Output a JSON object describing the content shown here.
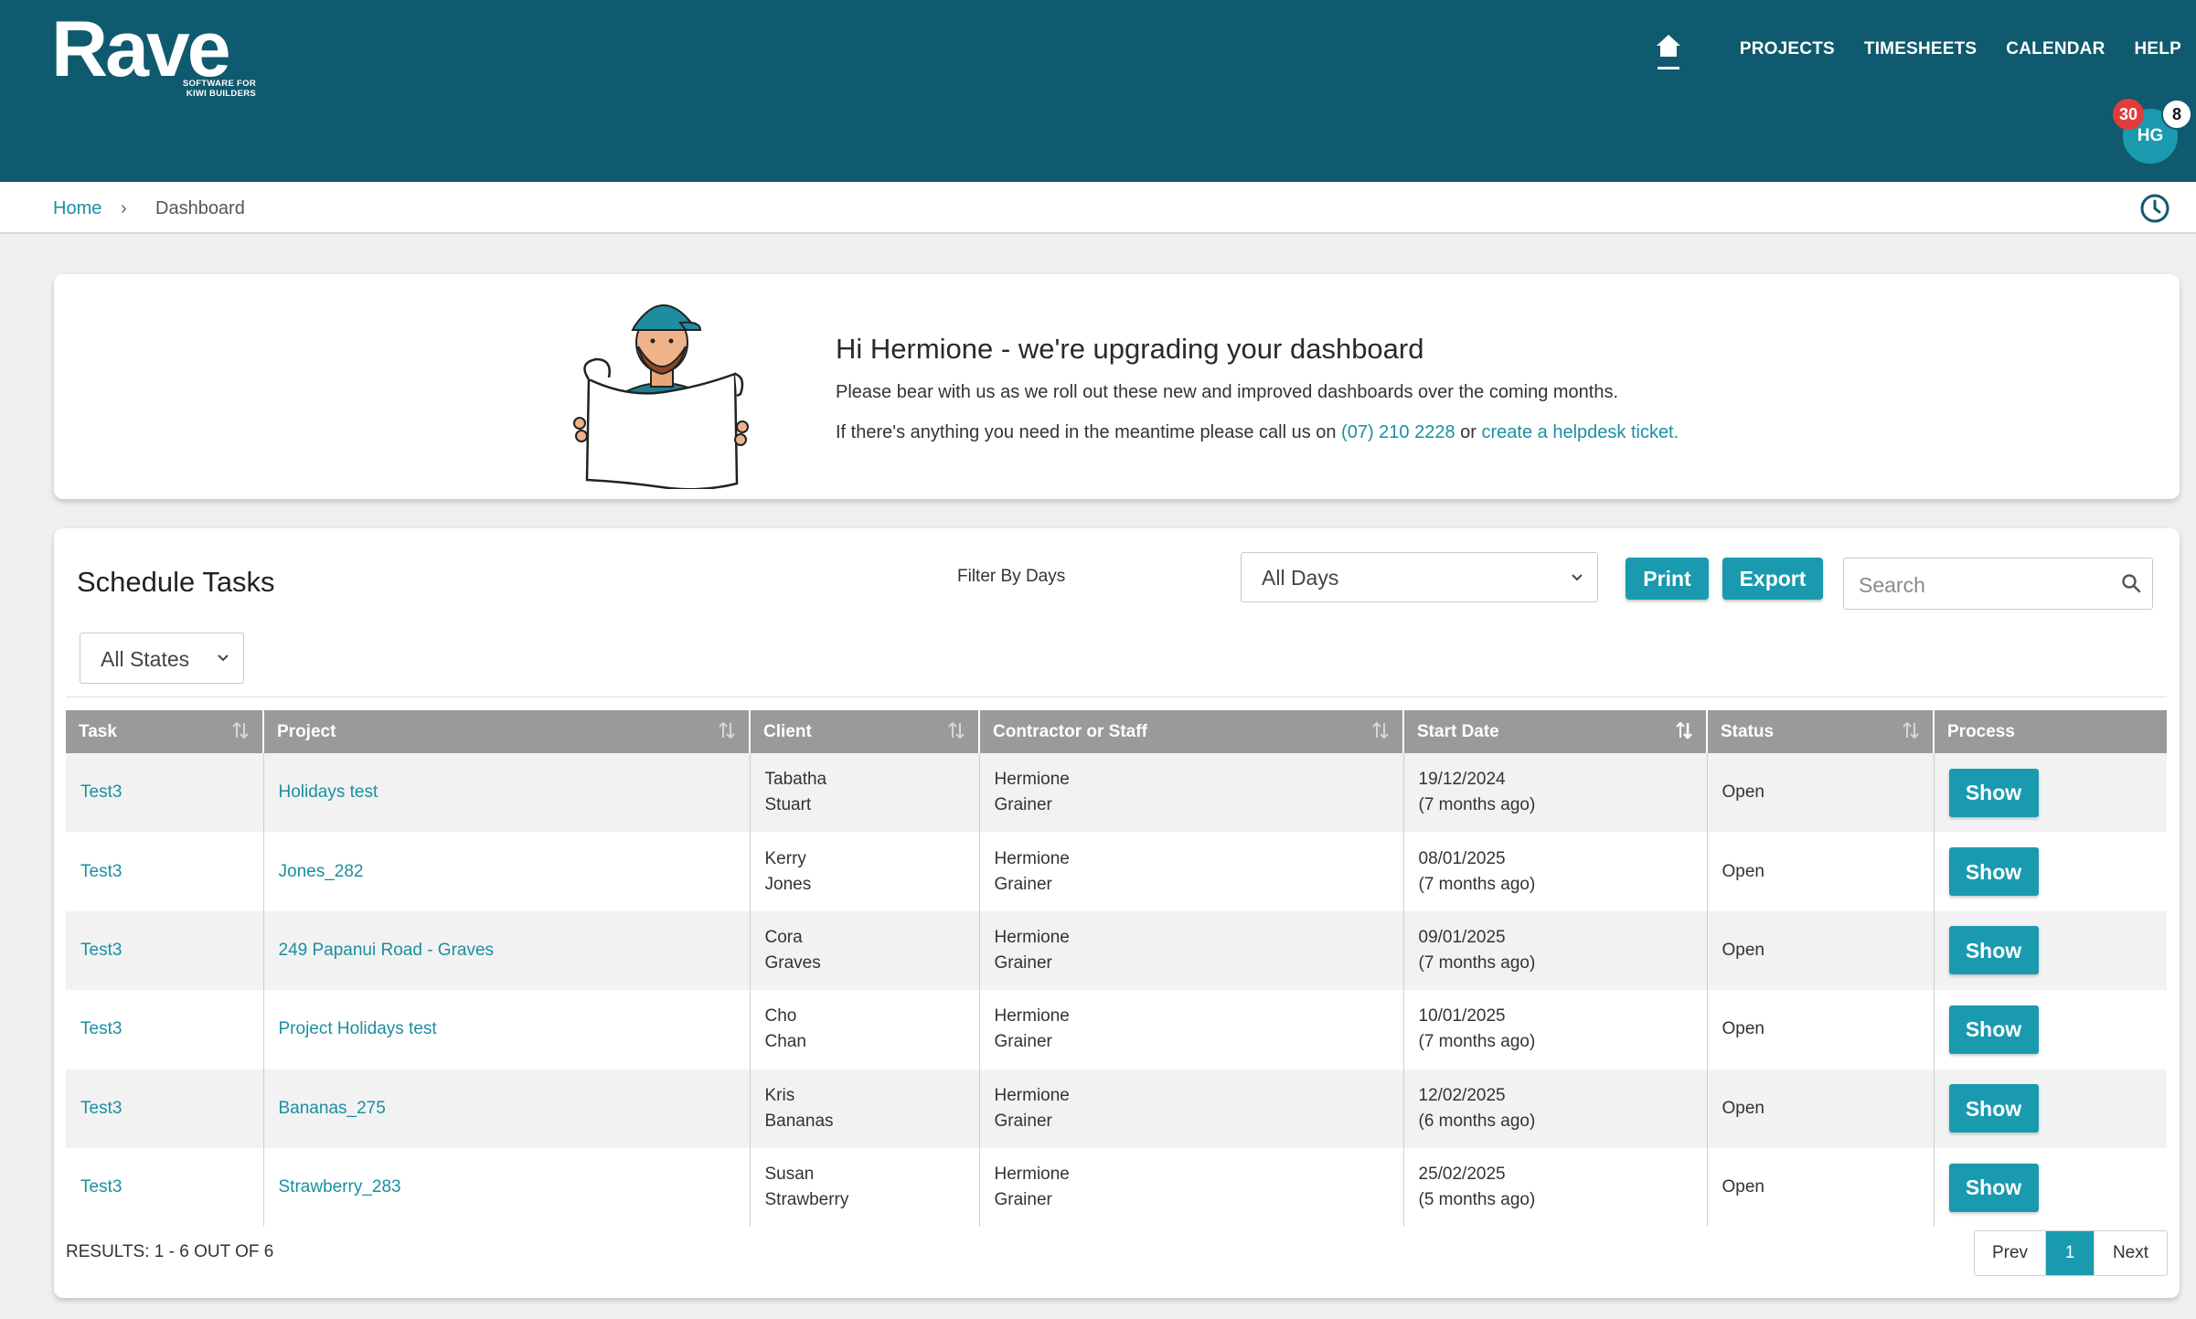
{
  "brand": {
    "name": "Rave",
    "tagline_1": "SOFTWARE FOR",
    "tagline_2": "KIWI BUILDERS"
  },
  "nav": {
    "items": [
      "PROJECTS",
      "TIMESHEETS",
      "CALENDAR",
      "HELP"
    ]
  },
  "user": {
    "initials": "HG",
    "notifications": "30",
    "messages": "8"
  },
  "breadcrumb": {
    "home": "Home",
    "separator": "›",
    "current": "Dashboard"
  },
  "welcome": {
    "title": "Hi Hermione - we're upgrading your dashboard",
    "line1": "Please bear with us as we roll out these new and improved dashboards over the coming months.",
    "line2_prefix": "If there's anything you need in the meantime please call us on ",
    "phone": "(07) 210 2228",
    "line2_mid": " or ",
    "helpdesk_link": "create a helpdesk ticket."
  },
  "tasks": {
    "title": "Schedule Tasks",
    "filter_label": "Filter By Days",
    "days_selected": "All Days",
    "states_selected": "All States",
    "print_label": "Print",
    "export_label": "Export",
    "search_placeholder": "Search",
    "columns": [
      "Task",
      "Project",
      "Client",
      "Contractor or Staff",
      "Start Date",
      "Status",
      "Process"
    ],
    "rows": [
      {
        "task": "Test3",
        "project": "Holidays test",
        "client_first": "Tabatha",
        "client_last": "Stuart",
        "staff_first": "Hermione",
        "staff_last": "Grainer",
        "date": "19/12/2024",
        "ago": "(7 months ago)",
        "status": "Open",
        "action": "Show"
      },
      {
        "task": "Test3",
        "project": "Jones_282",
        "client_first": "Kerry",
        "client_last": "Jones",
        "staff_first": "Hermione",
        "staff_last": "Grainer",
        "date": "08/01/2025",
        "ago": "(7 months ago)",
        "status": "Open",
        "action": "Show"
      },
      {
        "task": "Test3",
        "project": "249 Papanui Road - Graves",
        "client_first": "Cora",
        "client_last": "Graves",
        "staff_first": "Hermione",
        "staff_last": "Grainer",
        "date": "09/01/2025",
        "ago": "(7 months ago)",
        "status": "Open",
        "action": "Show"
      },
      {
        "task": "Test3",
        "project": "Project Holidays test",
        "client_first": "Cho",
        "client_last": "Chan",
        "staff_first": "Hermione",
        "staff_last": "Grainer",
        "date": "10/01/2025",
        "ago": "(7 months ago)",
        "status": "Open",
        "action": "Show"
      },
      {
        "task": "Test3",
        "project": "Bananas_275",
        "client_first": "Kris",
        "client_last": "Bananas",
        "staff_first": "Hermione",
        "staff_last": "Grainer",
        "date": "12/02/2025",
        "ago": "(6 months ago)",
        "status": "Open",
        "action": "Show"
      },
      {
        "task": "Test3",
        "project": "Strawberry_283",
        "client_first": "Susan",
        "client_last": "Strawberry",
        "staff_first": "Hermione",
        "staff_last": "Grainer",
        "date": "25/02/2025",
        "ago": "(5 months ago)",
        "status": "Open",
        "action": "Show"
      }
    ],
    "results_text": "RESULTS: 1 - 6 OUT OF 6",
    "pager": {
      "prev": "Prev",
      "current": "1",
      "next": "Next"
    }
  },
  "colors": {
    "header": "#0f5a6e",
    "accent": "#1a9aae",
    "link": "#1a8fa0",
    "badge": "#e33b3b"
  }
}
